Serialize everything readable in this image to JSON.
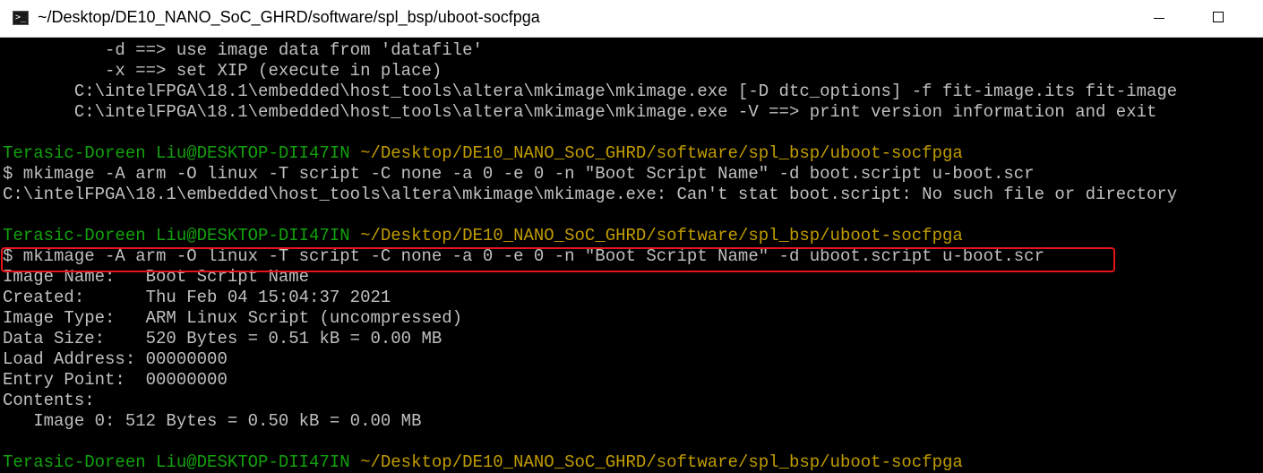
{
  "window": {
    "title": "~/Desktop/DE10_NANO_SoC_GHRD/software/spl_bsp/uboot-socfpga",
    "icon": "terminal-icon"
  },
  "terminal": {
    "colors": {
      "background": "#000000",
      "text": "#c0c0c0",
      "prompt_user": "#13a10e",
      "prompt_path": "#c19c00",
      "highlight_border": "#e8141b"
    },
    "lines": [
      {
        "text": "          -d ==> use image data from 'datafile'"
      },
      {
        "text": "          -x ==> set XIP (execute in place)"
      },
      {
        "text": "       C:\\intelFPGA\\18.1\\embedded\\host_tools\\altera\\mkimage\\mkimage.exe [-D dtc_options] -f fit-image.its fit-image"
      },
      {
        "text": "       C:\\intelFPGA\\18.1\\embedded\\host_tools\\altera\\mkimage\\mkimage.exe -V ==> print version information and exit"
      },
      {
        "text": ""
      },
      {
        "user": "Terasic-Doreen Liu@DESKTOP-DII47IN",
        "path": " ~/Desktop/DE10_NANO_SoC_GHRD/software/spl_bsp/uboot-socfpga"
      },
      {
        "text": "$ mkimage -A arm -O linux -T script -C none -a 0 -e 0 -n \"Boot Script Name\" -d boot.script u-boot.scr"
      },
      {
        "text": "C:\\intelFPGA\\18.1\\embedded\\host_tools\\altera\\mkimage\\mkimage.exe: Can't stat boot.script: No such file or directory"
      },
      {
        "text": ""
      },
      {
        "user": "Terasic-Doreen Liu@DESKTOP-DII47IN",
        "path": " ~/Desktop/DE10_NANO_SoC_GHRD/software/spl_bsp/uboot-socfpga"
      },
      {
        "text": "$ mkimage -A arm -O linux -T script -C none -a 0 -e 0 -n \"Boot Script Name\" -d uboot.script u-boot.scr"
      },
      {
        "text": "Image Name:   Boot Script Name"
      },
      {
        "text": "Created:      Thu Feb 04 15:04:37 2021"
      },
      {
        "text": "Image Type:   ARM Linux Script (uncompressed)"
      },
      {
        "text": "Data Size:    520 Bytes = 0.51 kB = 0.00 MB"
      },
      {
        "text": "Load Address: 00000000"
      },
      {
        "text": "Entry Point:  00000000"
      },
      {
        "text": "Contents:"
      },
      {
        "text": "   Image 0: 512 Bytes = 0.50 kB = 0.00 MB"
      },
      {
        "text": ""
      },
      {
        "user": "Terasic-Doreen Liu@DESKTOP-DII47IN",
        "path": " ~/Desktop/DE10_NANO_SoC_GHRD/software/spl_bsp/uboot-socfpga"
      }
    ]
  }
}
